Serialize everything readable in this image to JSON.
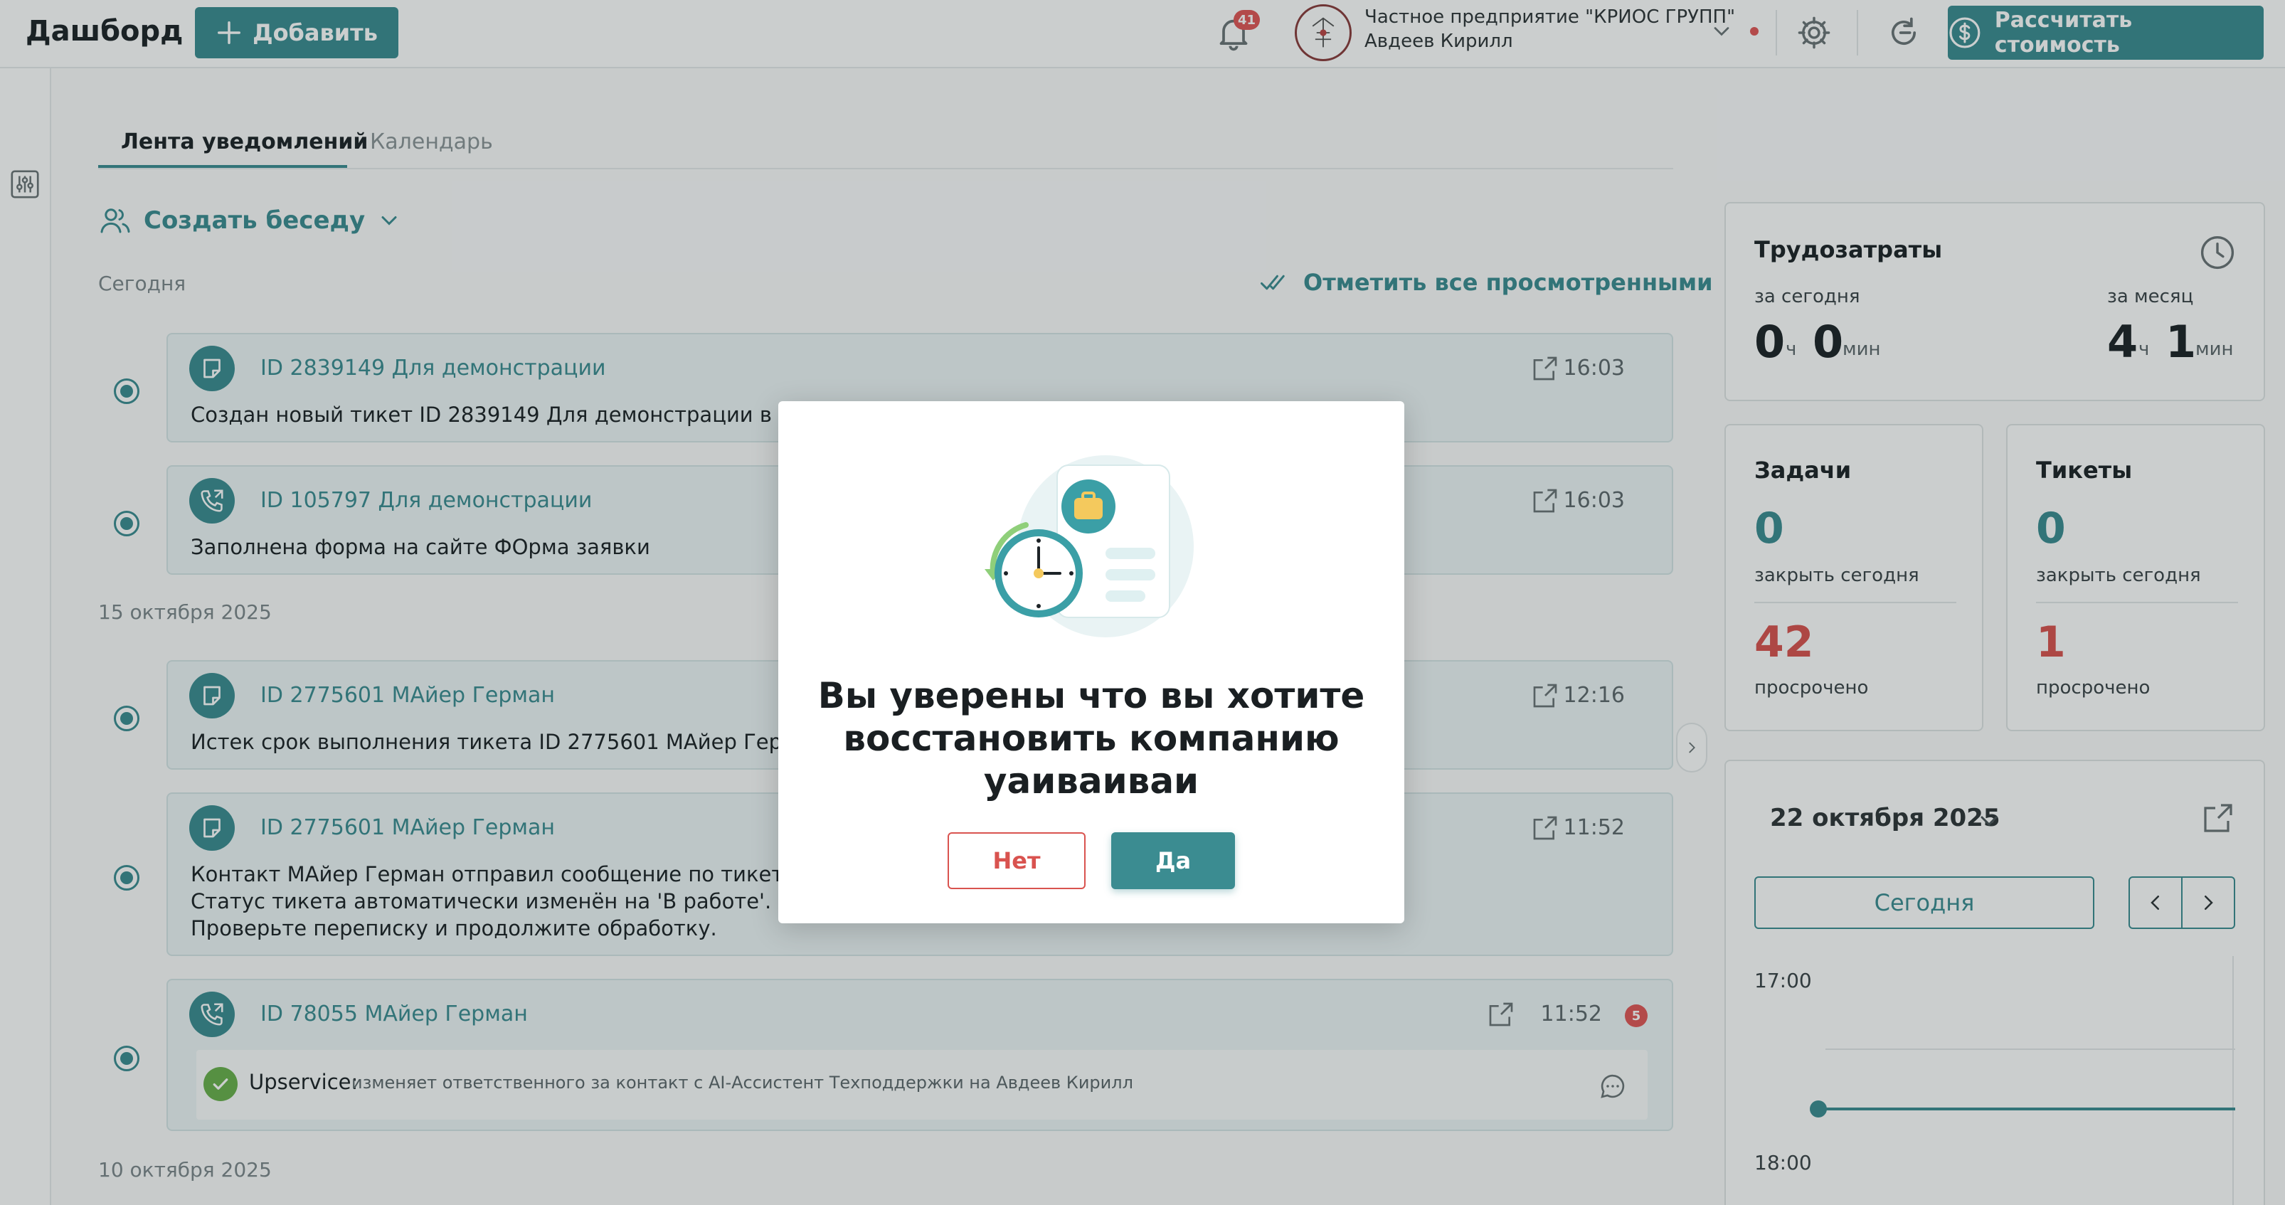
{
  "header": {
    "title": "Дашборд",
    "add_label": "Добавить",
    "notifications_count": "41",
    "company_name": "Частное предприятие \"КРИОС ГРУПП\"",
    "user_name": "Авдеев Кирилл",
    "calc_label": "Рассчитать стоимость"
  },
  "tabs": [
    {
      "label": "Лента уведомлений",
      "active": true
    },
    {
      "label": "Календарь",
      "active": false
    }
  ],
  "feed": {
    "create_chat_label": "Создать беседу",
    "mark_all_label": "Отметить все просмотренными",
    "groups": [
      {
        "date_label": "Сегодня",
        "items": [
          {
            "icon": "ticket-icon",
            "title": "ID 2839149 Для демонстрации",
            "time": "16:03",
            "body": "Создан новый тикет ID 2839149 Для демонстрации в системе"
          },
          {
            "icon": "phone-icon",
            "title": "ID 105797 Для демонстрации",
            "time": "16:03",
            "body": "Заполнена форма на сайте ФОрма заявки"
          }
        ]
      },
      {
        "date_label": "15 октября 2025",
        "items": [
          {
            "icon": "ticket-icon",
            "title": "ID 2775601 МАйер Герман",
            "time": "12:16",
            "body": "Истек срок выполнения тикета ID 2775601 МАйер Герман."
          },
          {
            "icon": "ticket-icon",
            "title": "ID 2775601 МАйер Герман",
            "time": "11:52",
            "body": "Контакт МАйер Герман отправил сообщение по тикету #277\nСтатус тикета автоматически изменён на 'В работе'.\nПроверьте переписку и продолжите обработку."
          },
          {
            "icon": "phone-icon",
            "title": "ID 78055 МАйер Герман",
            "time": "11:52",
            "badge": "5",
            "ai_name": "Upservice:",
            "ai_text": "изменяет ответственного за контакт с AI-Ассистент Техподдержки на Авдеев Кирилл"
          }
        ]
      },
      {
        "date_label": "10 октября 2025",
        "items": []
      }
    ]
  },
  "labor": {
    "title": "Трудозатраты",
    "today_label": "за сегодня",
    "today_hours": "0",
    "today_minutes": "0",
    "month_label": "за месяц",
    "month_hours": "4",
    "month_minutes": "1",
    "hours_unit": "ч",
    "minutes_unit": "мин"
  },
  "tasks": {
    "title": "Задачи",
    "close_today": "0",
    "close_today_label": "закрыть сегодня",
    "overdue": "42",
    "overdue_label": "просрочено"
  },
  "tickets": {
    "title": "Тикеты",
    "close_today": "0",
    "close_today_label": "закрыть сегодня",
    "overdue": "1",
    "overdue_label": "просрочено"
  },
  "calendar": {
    "date": "22 октября 2025",
    "today_label": "Сегодня",
    "times": [
      "17:00",
      "18:00"
    ]
  },
  "modal": {
    "message": "Вы уверены что вы хотите восстановить компанию уаиваиваи",
    "no_label": "Нет",
    "yes_label": "Да"
  },
  "colors": {
    "accent": "#3b8c91",
    "danger": "#d9534f",
    "card_bg": "#eef5f6"
  }
}
